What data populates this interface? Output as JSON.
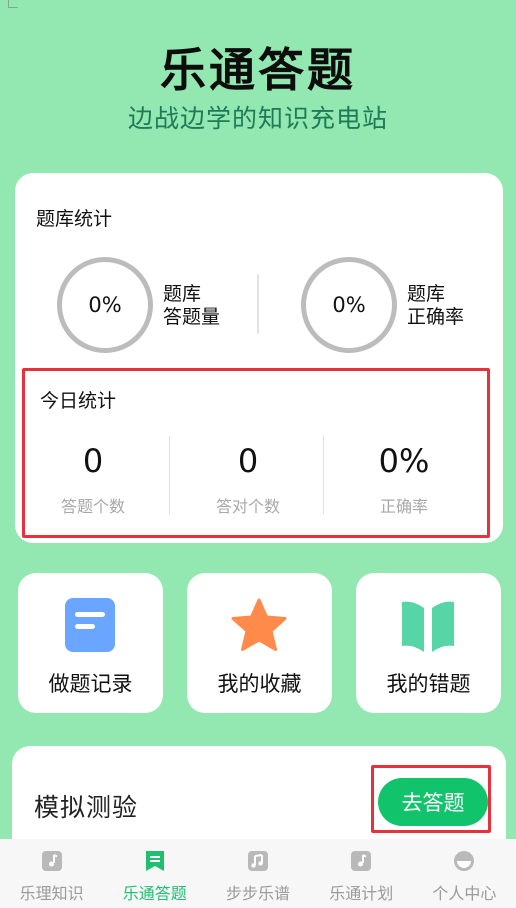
{
  "hero": {
    "title": "乐通答题",
    "subtitle": "边战边学的知识充电站"
  },
  "question_bank": {
    "title": "题库统计",
    "answered": {
      "value": "0%",
      "label_line1": "题库",
      "label_line2": "答题量"
    },
    "accuracy": {
      "value": "0%",
      "label_line1": "题库",
      "label_line2": "正确率"
    }
  },
  "today": {
    "title": "今日统计",
    "items": [
      {
        "value": "0",
        "label": "答题个数"
      },
      {
        "value": "0",
        "label": "答对个数"
      },
      {
        "value": "0%",
        "label": "正确率"
      }
    ]
  },
  "shortcuts": [
    {
      "label": "做题记录",
      "icon": "document-icon",
      "color": "#6aa5ff"
    },
    {
      "label": "我的收藏",
      "icon": "star-icon",
      "color": "#ff8a4a"
    },
    {
      "label": "我的错题",
      "icon": "book-icon",
      "color": "#56d6a6"
    }
  ],
  "mock_test": {
    "title": "模拟测验",
    "button_label": "去答题"
  },
  "tabbar": {
    "items": [
      {
        "label": "乐理知识",
        "icon": "music-note-icon",
        "active": false
      },
      {
        "label": "乐通答题",
        "icon": "bookmark-icon",
        "active": true
      },
      {
        "label": "步步乐谱",
        "icon": "music-score-icon",
        "active": false
      },
      {
        "label": "乐通计划",
        "icon": "plan-icon",
        "active": false
      },
      {
        "label": "个人中心",
        "icon": "profile-icon",
        "active": false
      }
    ]
  },
  "colors": {
    "background": "#93e8b1",
    "accent": "#11c36b",
    "highlight_border": "#e5323c"
  }
}
